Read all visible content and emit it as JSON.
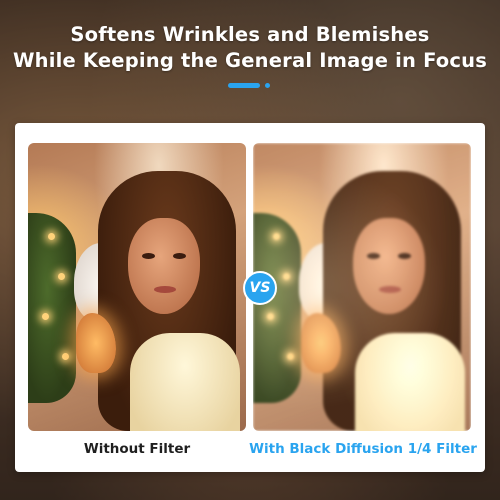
{
  "headline": {
    "line1": "Softens Wrinkles and Blemishes",
    "line2": "While Keeping the General Image in Focus"
  },
  "comparison": {
    "badge": "VS",
    "left_label": "Without Filter",
    "right_label": "With Black Diffusion 1/4 Filter"
  },
  "colors": {
    "accent": "#2aa4ef",
    "headline_text": "#ffffff",
    "left_label_text": "#1f1f1f"
  }
}
